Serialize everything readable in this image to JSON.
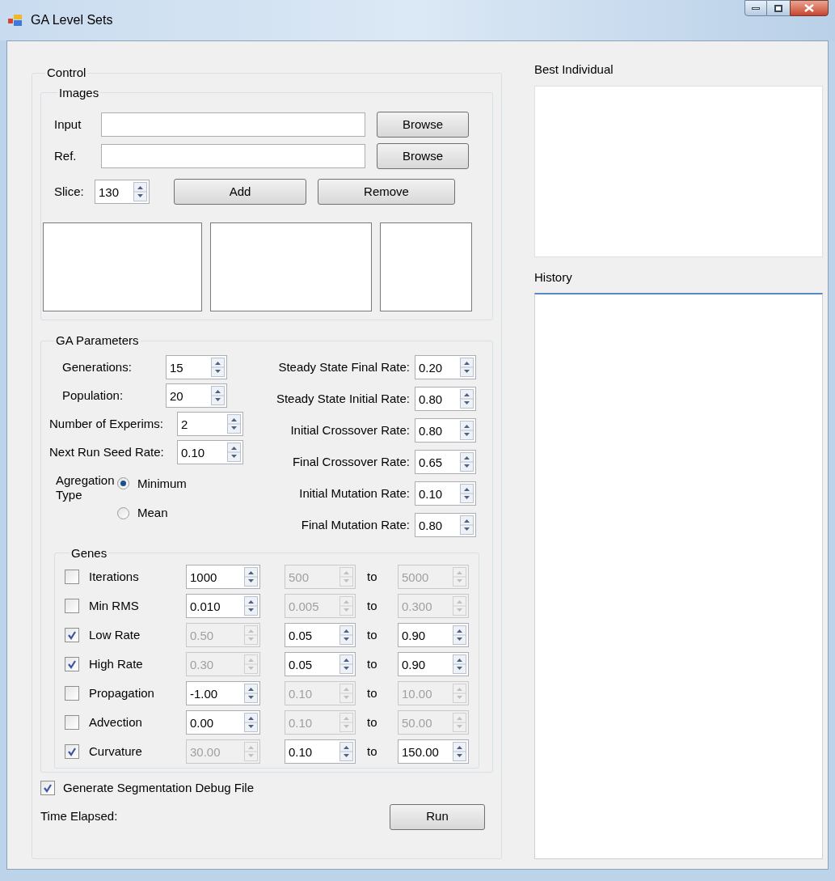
{
  "window": {
    "title": "GA Level Sets"
  },
  "control": {
    "title": "Control",
    "images": {
      "title": "Images",
      "input_label": "Input",
      "input_button": "Browse",
      "ref_label": "Ref.",
      "ref_button": "Browse",
      "slice_label": "Slice:",
      "slice_value": "130",
      "add_button": "Add",
      "remove_button": "Remove"
    },
    "ga": {
      "title": "GA Parameters",
      "left": [
        {
          "label": "Generations:",
          "value": "15"
        },
        {
          "label": "Population:",
          "value": "20"
        },
        {
          "label": "Number of Experims:",
          "value": "2"
        },
        {
          "label": "Next Run Seed Rate:",
          "value": "0.10"
        }
      ],
      "right": [
        {
          "label": "Steady State Final Rate:",
          "value": "0.20"
        },
        {
          "label": "Steady State Initial Rate:",
          "value": "0.80"
        },
        {
          "label": "Initial Crossover Rate:",
          "value": "0.80"
        },
        {
          "label": "Final Crossover Rate:",
          "value": "0.65"
        },
        {
          "label": "Initial Mutation Rate:",
          "value": "0.10"
        },
        {
          "label": "Final Mutation Rate:",
          "value": "0.80"
        }
      ],
      "aggregation": {
        "label": "Agregation Type",
        "options": [
          {
            "label": "Minimum",
            "selected": true
          },
          {
            "label": "Mean",
            "selected": false
          }
        ]
      },
      "genes": {
        "title": "Genes",
        "rows": [
          {
            "name": "Iterations",
            "checked": false,
            "value": {
              "text": "1000",
              "disabled": false
            },
            "min": {
              "text": "500",
              "disabled": true
            },
            "to": "to",
            "max": {
              "text": "5000",
              "disabled": true
            }
          },
          {
            "name": "Min RMS",
            "checked": false,
            "value": {
              "text": "0.010",
              "disabled": false
            },
            "min": {
              "text": "0.005",
              "disabled": true
            },
            "to": "to",
            "max": {
              "text": "0.300",
              "disabled": true
            }
          },
          {
            "name": "Low Rate",
            "checked": true,
            "value": {
              "text": "0.50",
              "disabled": true
            },
            "min": {
              "text": "0.05",
              "disabled": false
            },
            "to": "to",
            "max": {
              "text": "0.90",
              "disabled": false
            }
          },
          {
            "name": "High Rate",
            "checked": true,
            "value": {
              "text": "0.30",
              "disabled": true
            },
            "min": {
              "text": "0.05",
              "disabled": false
            },
            "to": "to",
            "max": {
              "text": "0.90",
              "disabled": false
            }
          },
          {
            "name": "Propagation",
            "checked": false,
            "value": {
              "text": "-1.00",
              "disabled": false
            },
            "min": {
              "text": "0.10",
              "disabled": true
            },
            "to": "to",
            "max": {
              "text": "10.00",
              "disabled": true
            }
          },
          {
            "name": "Advection",
            "checked": false,
            "value": {
              "text": "0.00",
              "disabled": false
            },
            "min": {
              "text": "0.10",
              "disabled": true
            },
            "to": "to",
            "max": {
              "text": "50.00",
              "disabled": true
            }
          },
          {
            "name": "Curvature",
            "checked": true,
            "value": {
              "text": "30.00",
              "disabled": true
            },
            "min": {
              "text": "0.10",
              "disabled": false
            },
            "to": "to",
            "max": {
              "text": "150.00",
              "disabled": false
            }
          }
        ]
      }
    },
    "debug": {
      "label": "Generate Segmentation Debug File",
      "checked": true
    },
    "time_elapsed": "Time Elapsed:",
    "run_button": "Run"
  },
  "best_individual": {
    "title": "Best Individual"
  },
  "history": {
    "title": "History"
  }
}
